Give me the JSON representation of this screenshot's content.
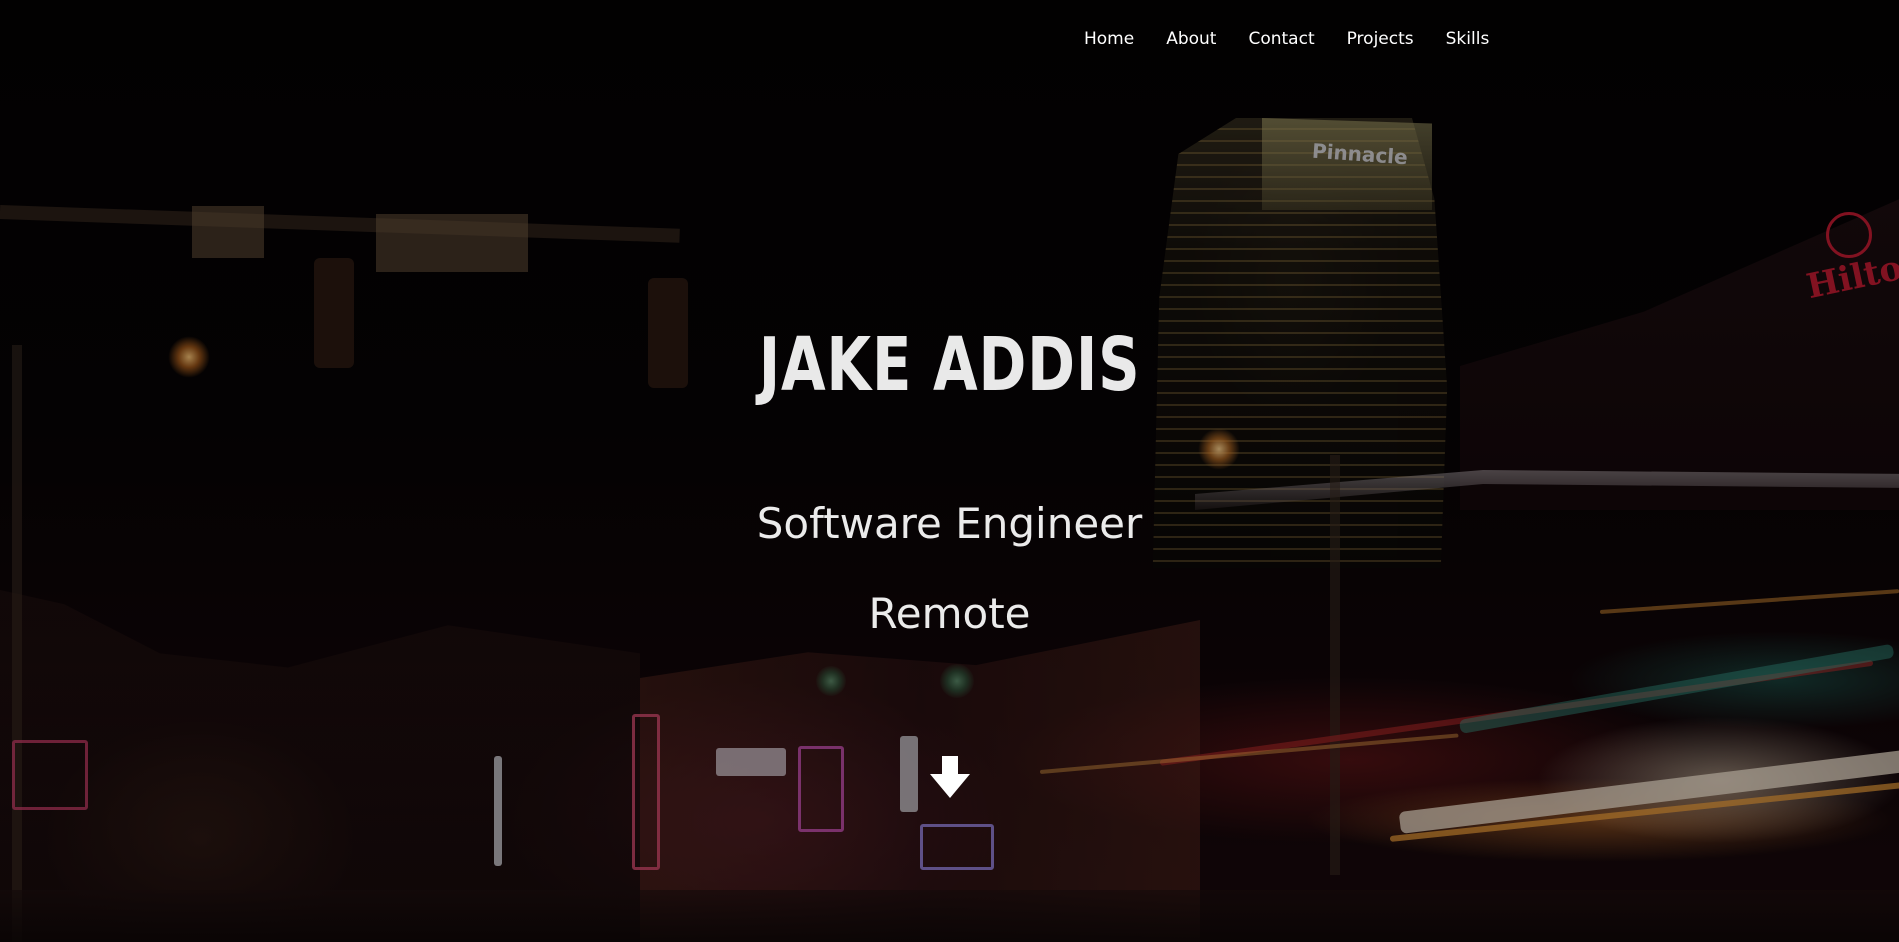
{
  "nav": {
    "items": [
      {
        "label": "Home"
      },
      {
        "label": "About"
      },
      {
        "label": "Contact"
      },
      {
        "label": "Projects"
      },
      {
        "label": "Skills"
      }
    ]
  },
  "hero": {
    "name": "JAKE ADDIS",
    "title": "Software Engineer",
    "location": "Remote",
    "scroll_icon": "arrow-down-icon",
    "background_scene": {
      "tower_sign_text": "Pinnacle",
      "hotel_sign_text": "Hilton"
    }
  },
  "colors": {
    "text": "#ebebeb",
    "nav_text": "#ffffff",
    "background": "#050304"
  }
}
